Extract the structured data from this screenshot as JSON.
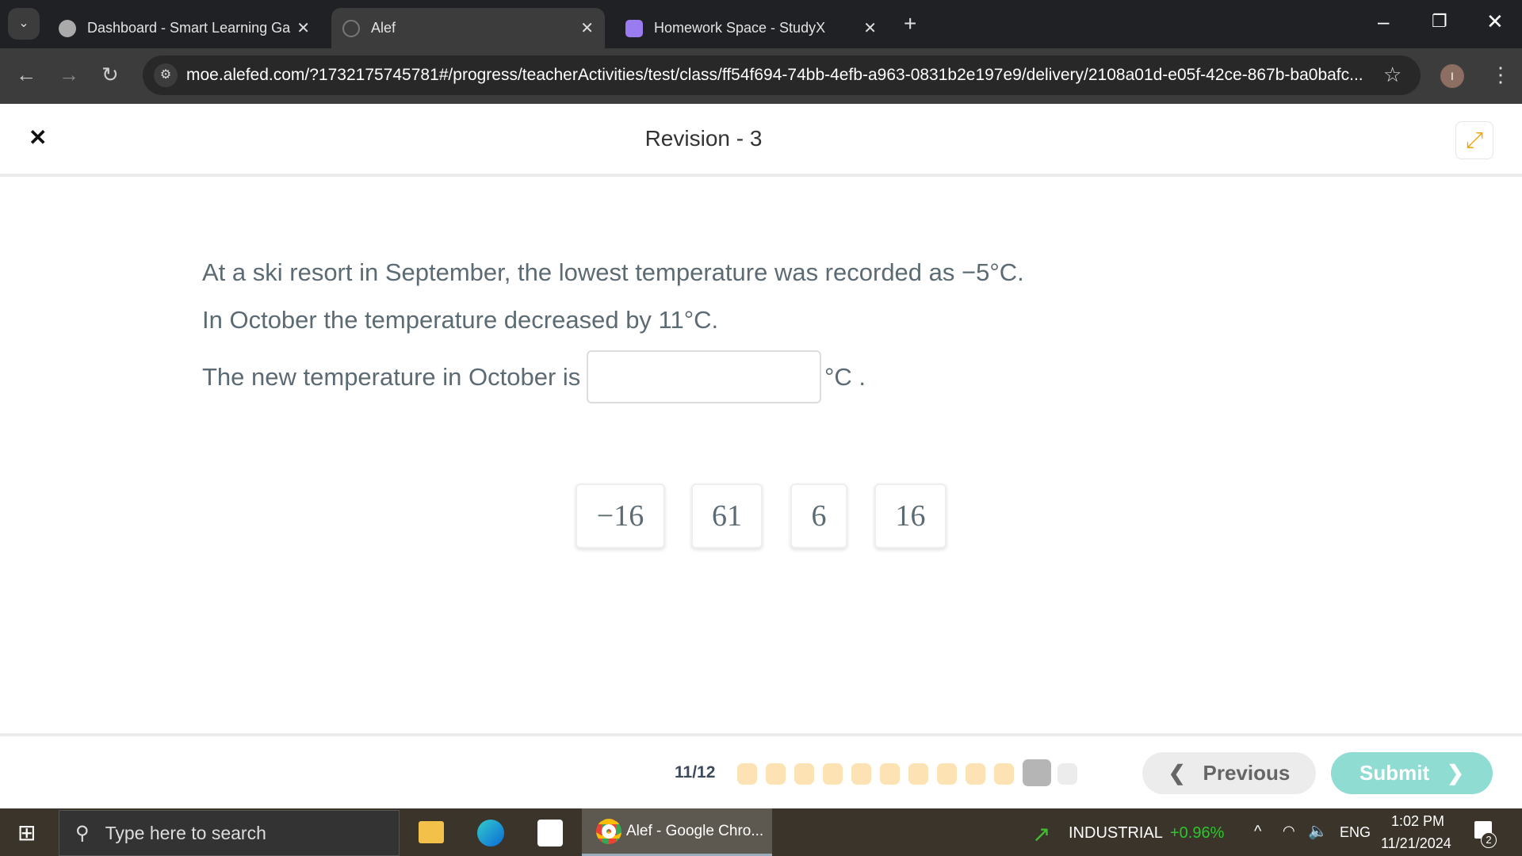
{
  "browser": {
    "tabs": [
      {
        "title": "Dashboard - Smart Learning Ga",
        "icon": "globe-icon"
      },
      {
        "title": "Alef",
        "icon": "alef-icon",
        "active": true
      },
      {
        "title": "Homework Space - StudyX",
        "icon": "studyx-icon"
      }
    ],
    "url": "moe.alefed.com/?1732175745781#/progress/teacherActivities/test/class/ff54f694-74bb-4efb-a963-0831b2e197e9/delivery/2108a01d-e05f-42ce-867b-ba0bafc...",
    "profile_initial": "I"
  },
  "header": {
    "title": "Revision - 3",
    "accent": "#f5a100"
  },
  "question": {
    "line1": "At a ski resort in September, the lowest temperature was recorded as −5°C.",
    "line2": "In October the temperature decreased by 11°C.",
    "line3": "The new temperature in October is",
    "unit": "°C .",
    "answer_value": ""
  },
  "options": [
    "−16",
    "61",
    "6",
    "16"
  ],
  "footer": {
    "progress": "11/12",
    "current": 11,
    "total": 12,
    "answered_color": "#fde3b3",
    "current_color": "#b5b5b5",
    "previous_label": "Previous",
    "submit_label": "Submit",
    "submit_color": "#8edcd2"
  },
  "taskbar": {
    "search_placeholder": "Type here to search",
    "active_app": "Alef - Google Chro...",
    "stock_name": "INDUSTRIAL",
    "stock_change": "+0.96%",
    "lang": "ENG",
    "time": "1:02 PM",
    "date": "11/21/2024",
    "notifications": "2"
  }
}
